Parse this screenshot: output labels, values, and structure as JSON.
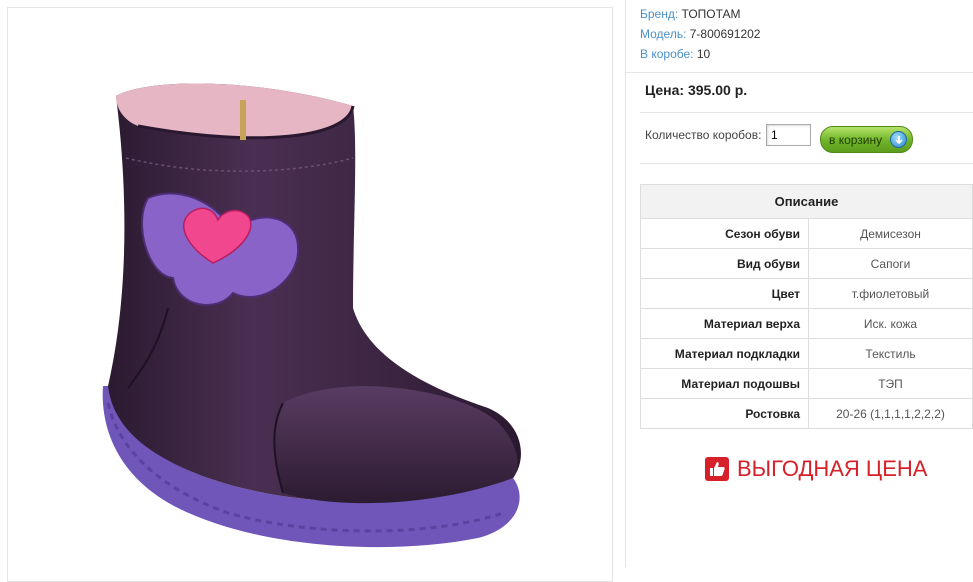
{
  "product_info": {
    "brand_key": "Бренд:",
    "brand_value": "ТОПОТАМ",
    "model_key": "Модель:",
    "model_value": "7-800691202",
    "box_key": "В коробе:",
    "box_value": "10"
  },
  "price": {
    "label": "Цена: 395.00 р."
  },
  "order": {
    "quantity_label": "Количество коробов:",
    "quantity_value": "1",
    "cart_button_label": "в корзину"
  },
  "specs": {
    "title": "Описание",
    "rows": [
      {
        "key": "Сезон обуви",
        "value": "Демисезон"
      },
      {
        "key": "Вид обуви",
        "value": "Сапоги"
      },
      {
        "key": "Цвет",
        "value": "т.фиолетовый"
      },
      {
        "key": "Материал верха",
        "value": "Иск. кожа"
      },
      {
        "key": "Материал подкладки",
        "value": "Текстиль"
      },
      {
        "key": "Материал подошвы",
        "value": "ТЭП"
      },
      {
        "key": "Ростовка",
        "value": "20-26 (1,1,1,1,2,2,2)"
      }
    ]
  },
  "promo": {
    "text": "ВЫГОДНАЯ ЦЕНА",
    "icon": "thumbs-up-icon",
    "color": "#d6202a"
  },
  "product_image": {
    "subject": "boot-image",
    "boot_color": "#3a2440",
    "sole_color": "#6f56b8",
    "patch_color": "#8a63c9",
    "heart_color": "#f0478f"
  },
  "colors": {
    "link": "#4a90c8",
    "cart_button": "#6fb327"
  }
}
